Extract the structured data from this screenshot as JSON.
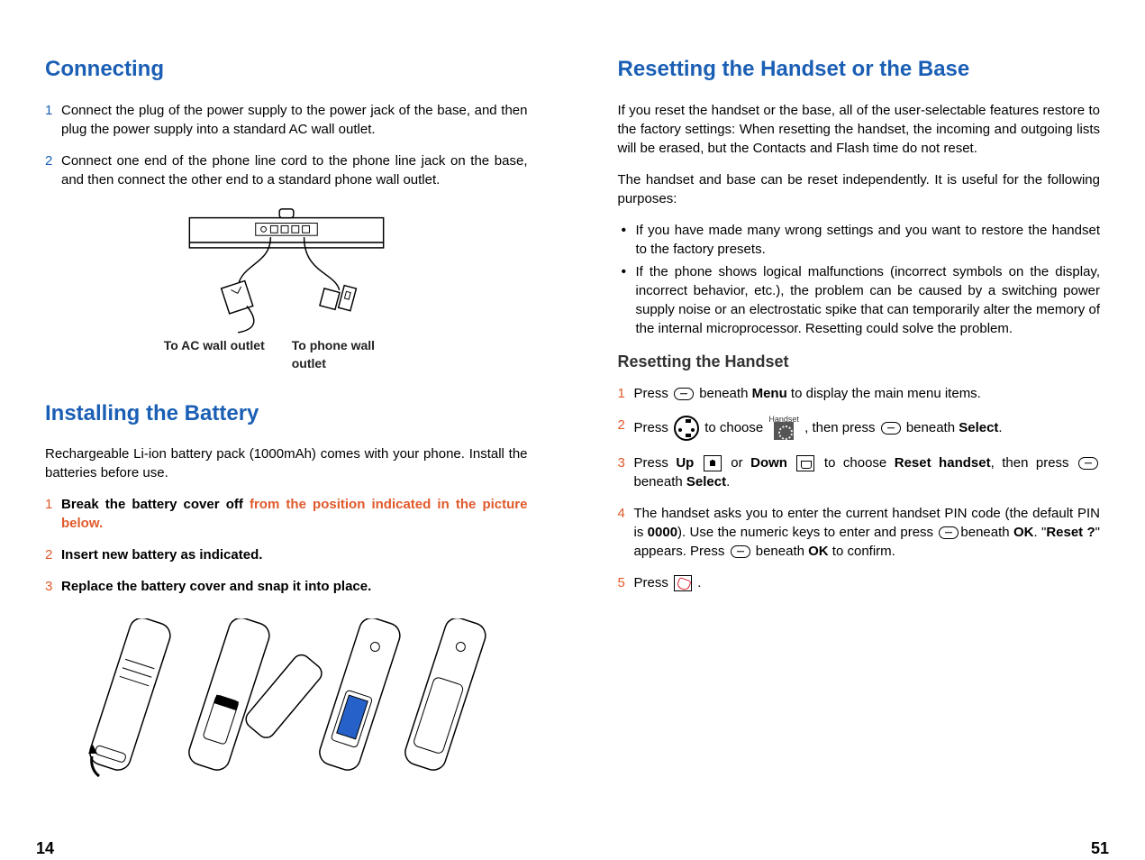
{
  "left": {
    "section1_title": "Connecting",
    "s1_step1": "Connect the plug of the power supply to the power jack of the base, and then plug the power supply into a standard AC wall outlet.",
    "s1_step2": "Connect one end of the phone line cord to the phone line jack on the base, and then connect the other end to a standard phone wall outlet.",
    "fig_ac_label": "To AC wall outlet",
    "fig_phone_label": "To phone wall outlet",
    "section2_title": "Installing the Battery",
    "s2_intro": "Rechargeable Li-ion battery pack (1000mAh) comes with your phone. Install the batteries before use.",
    "s2_step1_pre": "Break the battery cover off ",
    "s2_step1_red": "from the position indicated in the picture below.",
    "s2_step2": "Insert new battery as indicated.",
    "s2_step3": "Replace the battery cover and snap it into place.",
    "page_number": "14"
  },
  "right": {
    "section1_title": "Resetting the Handset or the Base",
    "s1_para1": "If you reset the handset or the base, all of the user-selectable features restore to the factory settings: When resetting the handset, the incoming and outgoing lists will be erased, but the Contacts and Flash time do not reset.",
    "s1_para2": "The handset and base can be reset independently. It is useful for the following purposes:",
    "s1_bullet1": "If you have made many wrong settings and you want to restore the handset to the factory presets.",
    "s1_bullet2": "If the phone shows logical malfunctions (incorrect symbols on the display, incorrect behavior, etc.), the problem can be caused by a switching power supply noise or an electrostatic spike that can temporarily alter the memory of the internal microprocessor. Resetting could solve the problem.",
    "sub_title": "Resetting the Handset",
    "step1_a": "Press ",
    "step1_b": " beneath ",
    "step1_menu": "Menu",
    "step1_c": " to display the main menu items.",
    "step2_a": "Press ",
    "step2_b": " to choose ",
    "step2_c": " , then press ",
    "step2_d": " beneath ",
    "step2_select": "Select",
    "step2_e": ".",
    "menu_icon_label": "Handset",
    "step3_a": "Press ",
    "step3_up": "Up",
    "step3_b": " or ",
    "step3_down": "Down",
    "step3_c": " to choose ",
    "step3_reset": "Reset handset",
    "step3_d": ", then press ",
    "step3_e": " beneath ",
    "step3_select": "Select",
    "step3_f": ".",
    "step4_a": "The handset asks you to enter the current handset PIN code (the default PIN is ",
    "step4_pin": "0000",
    "step4_b": "). Use the numeric keys to enter and press",
    "step4_c": "beneath ",
    "step4_ok1": "OK",
    "step4_d": ". \"",
    "step4_reset_q": "Reset ?",
    "step4_e": "\" appears. Press ",
    "step4_f": " beneath ",
    "step4_ok2": "OK",
    "step4_g": " to confirm.",
    "step5_a": "Press ",
    "step5_b": " .",
    "page_number": "51"
  }
}
